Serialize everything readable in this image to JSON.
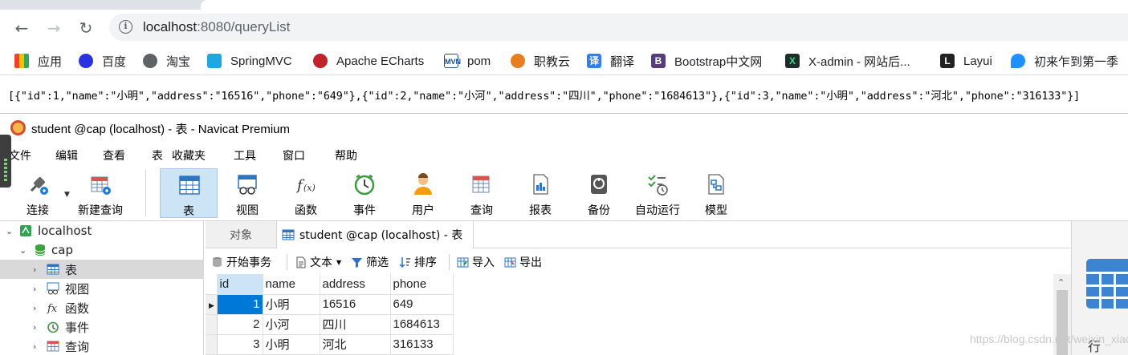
{
  "browser": {
    "address": {
      "host": "localhost",
      "rest": ":8080/queryList"
    },
    "bookmarks": [
      "应用",
      "百度",
      "淘宝",
      "SpringMVC",
      "Apache ECharts",
      "pom",
      "职教云",
      "翻译",
      "Bootstrap中文网",
      "X-admin - 网站后...",
      "Layui",
      "初来乍到第一季"
    ]
  },
  "json_output": "[{\"id\":1,\"name\":\"小明\",\"address\":\"16516\",\"phone\":\"649\"},{\"id\":2,\"name\":\"小河\",\"address\":\"四川\",\"phone\":\"1684613\"},{\"id\":3,\"name\":\"小明\",\"address\":\"河北\",\"phone\":\"316133\"}]",
  "navicat": {
    "title": "student @cap (localhost) - 表 - Navicat Premium",
    "menu": [
      "文件",
      "编辑",
      "查看",
      "表",
      "收藏夹",
      "工具",
      "窗口",
      "帮助"
    ],
    "toolbar": [
      "连接",
      "新建查询",
      "表",
      "视图",
      "函数",
      "事件",
      "用户",
      "查询",
      "报表",
      "备份",
      "自动运行",
      "模型"
    ],
    "tree": {
      "connection": "localhost",
      "database": "cap",
      "items": [
        "表",
        "视图",
        "函数",
        "事件",
        "查询"
      ]
    },
    "tabs": {
      "objects": "对象",
      "current": "student @cap (localhost) - 表"
    },
    "table_toolbar": [
      "开始事务",
      "文本",
      "筛选",
      "排序",
      "导入",
      "导出"
    ],
    "grid": {
      "columns": [
        "id",
        "name",
        "address",
        "phone"
      ],
      "rows": [
        [
          "1",
          "小明",
          "16516",
          "649"
        ],
        [
          "2",
          "小河",
          "四川",
          "1684613"
        ],
        [
          "3",
          "小明",
          "河北",
          "316133"
        ]
      ]
    },
    "right_panel_label": "行"
  },
  "watermark": "https://blog.csdn.net/weixin_xiaoly",
  "colors": {
    "selection": "#0078d7",
    "toolbar_active": "#cde4f7",
    "address_bar": "#f1f3f4"
  }
}
